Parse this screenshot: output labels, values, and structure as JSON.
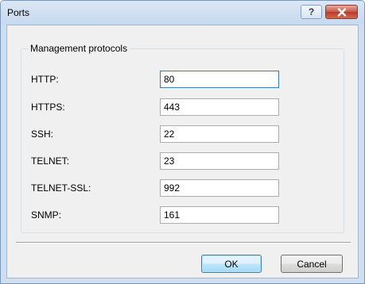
{
  "window": {
    "title": "Ports",
    "help_glyph": "?",
    "close_icon": "close-icon"
  },
  "group": {
    "legend": "Management protocols",
    "fields": [
      {
        "label": "HTTP:",
        "value": "80"
      },
      {
        "label": "HTTPS:",
        "value": "443"
      },
      {
        "label": "SSH:",
        "value": "22"
      },
      {
        "label": "TELNET:",
        "value": "23"
      },
      {
        "label": "TELNET-SSL:",
        "value": "992"
      },
      {
        "label": "SNMP:",
        "value": "161"
      }
    ]
  },
  "buttons": {
    "ok": "OK",
    "cancel": "Cancel"
  },
  "colors": {
    "titlebar": "#c6d9ee",
    "close_button": "#c75a46",
    "dialog_background": "#f0f0f0"
  }
}
